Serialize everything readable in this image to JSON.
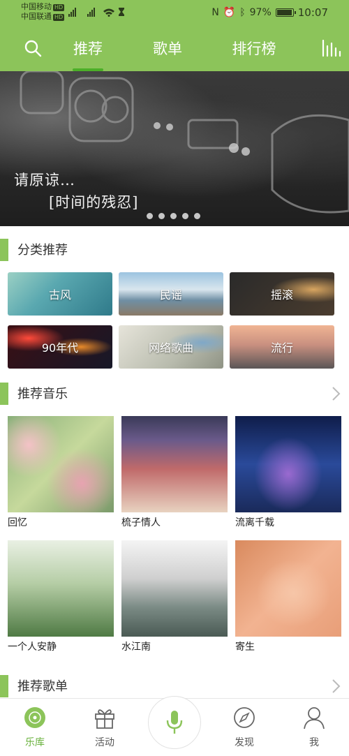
{
  "status_bar": {
    "carrier1": "中国移动",
    "carrier2": "中国联通",
    "hd": "HD",
    "battery": "97%",
    "battery_level": 0.97,
    "time": "10:07"
  },
  "top_nav": {
    "tabs": [
      {
        "label": "推荐",
        "active": true
      },
      {
        "label": "歌单",
        "active": false
      },
      {
        "label": "排行榜",
        "active": false
      }
    ],
    "accent": "#8cc45a"
  },
  "banner": {
    "line1": "请原谅…",
    "line2": "[时间的残忍]",
    "dot_count": 5
  },
  "categories": {
    "title": "分类推荐",
    "items": [
      "古风",
      "民谣",
      "摇滚",
      "90年代",
      "网络歌曲",
      "流行"
    ]
  },
  "recommended_music": {
    "title": "推荐音乐",
    "items": [
      "回忆",
      "梳子情人",
      "流离千载",
      "一个人安静",
      "水江南",
      "寄生"
    ]
  },
  "recommended_playlists": {
    "title": "推荐歌单"
  },
  "bottom_nav": {
    "items": [
      {
        "label": "乐库",
        "icon": "disc-icon",
        "active": true
      },
      {
        "label": "活动",
        "icon": "gift-icon",
        "active": false
      },
      {
        "label": "发现",
        "icon": "compass-icon",
        "active": false
      },
      {
        "label": "我",
        "icon": "person-icon",
        "active": false
      }
    ],
    "center_icon": "microphone-icon",
    "active_color": "#6ab23e"
  }
}
